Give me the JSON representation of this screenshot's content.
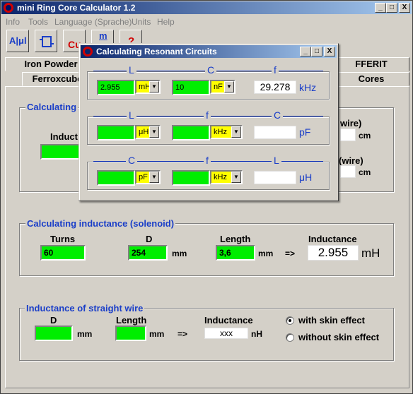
{
  "app": {
    "title": "mini Ring Core Calculator 1.2",
    "menu": [
      "Info",
      "Tools",
      "Language (Sprache)",
      "Units",
      "Help"
    ],
    "caption_buttons": [
      "_",
      "□",
      "X"
    ]
  },
  "toolbar": {
    "buttons": [
      {
        "icon": "al-mu-icon",
        "label": "A|μl"
      },
      {
        "icon": "circuit-icon",
        "label": ""
      },
      {
        "icon": "cu-wire-icon",
        "label": "Cu"
      },
      {
        "icon": "m-icon",
        "label": "m"
      },
      {
        "icon": "help-icon",
        "label": "?"
      }
    ]
  },
  "tabs": {
    "row1": [
      "Iron Powder",
      "FFERIT"
    ],
    "row2": [
      "Ferroxcube",
      "Cores"
    ]
  },
  "ring_panel": {
    "title": "Calculating",
    "inductance_label": "Induct",
    "wire1_label": "wire)",
    "wire1_unit": "cm",
    "wire2_label": "(wire)",
    "wire2_unit": "cm"
  },
  "solenoid": {
    "title": "Calculating inductance (solenoid)",
    "turns_label": "Turns",
    "turns_value": "60",
    "d_label": "D",
    "d_value": "254",
    "d_unit": "mm",
    "length_label": "Length",
    "length_value": "3,6",
    "length_unit": "mm",
    "arrow": "=>",
    "inductance_label": "Inductance",
    "inductance_value": "2.955",
    "inductance_unit": "mH"
  },
  "wire": {
    "title": "Inductance of straight wire",
    "d_label": "D",
    "d_value": "",
    "d_unit": "mm",
    "length_label": "Length",
    "length_value": "",
    "length_unit": "mm",
    "arrow": "=>",
    "inductance_label": "Inductance",
    "inductance_value": "xxx",
    "inductance_unit": "nH",
    "radio_with": "with skin effect",
    "radio_without": "without skin effect",
    "selected": "with"
  },
  "dialog": {
    "title": "Calculating Resonant Circuits",
    "caption_buttons": [
      "_",
      "□",
      "X"
    ],
    "row1": {
      "labels": [
        "L",
        "C",
        "f"
      ],
      "in1_value": "2.955",
      "in1_unit": "mH",
      "in2_value": "10",
      "in2_unit": "nF",
      "result": "29.278",
      "result_unit": "kHz"
    },
    "row2": {
      "labels": [
        "L",
        "f",
        "C"
      ],
      "in1_value": "",
      "in1_unit": "μH",
      "in2_value": "",
      "in2_unit": "kHz",
      "result": "",
      "result_unit": "pF"
    },
    "row3": {
      "labels": [
        "C",
        "f",
        "L"
      ],
      "in1_value": "",
      "in1_unit": "pF",
      "in2_value": "",
      "in2_unit": "kHz",
      "result": "",
      "result_unit": "μH"
    }
  }
}
